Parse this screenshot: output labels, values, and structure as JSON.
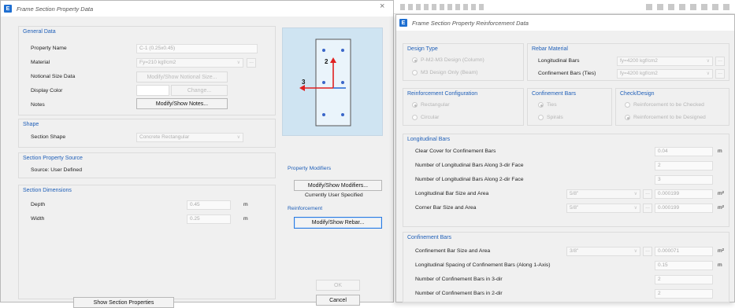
{
  "main": {
    "title": "Frame Section Property Data",
    "general": {
      "header": "General Data",
      "property_name_label": "Property Name",
      "property_name_value": "C-1 (0.25x0.45)",
      "material_label": "Material",
      "material_value": "Fy=210 kgf/cm2",
      "notional_label": "Notional Size Data",
      "notional_button": "Modify/Show Notional Size...",
      "display_color_label": "Display Color",
      "change_button": "Change...",
      "notes_label": "Notes",
      "notes_button": "Modify/Show Notes..."
    },
    "shape": {
      "header": "Shape",
      "section_shape_label": "Section Shape",
      "section_shape_value": "Concrete Rectangular"
    },
    "source": {
      "header": "Section Property Source",
      "source_text": "Source:  User Defined"
    },
    "dimensions": {
      "header": "Section Dimensions",
      "depth_label": "Depth",
      "depth_value": "0.45",
      "depth_unit": "m",
      "width_label": "Width",
      "width_value": "0.25",
      "width_unit": "m"
    },
    "preview": {
      "axis2_label": "2",
      "axis3_label": "3"
    },
    "modifiers": {
      "header": "Property Modifiers",
      "button": "Modify/Show Modifiers...",
      "status": "Currently User Specified"
    },
    "reinforcement": {
      "header": "Reinforcement",
      "button": "Modify/Show Rebar..."
    },
    "show_props_button": "Show Section Properties",
    "ok_button": "OK",
    "cancel_button": "Cancel"
  },
  "rebar": {
    "title": "Frame Section Property Reinforcement Data",
    "design_type": {
      "header": "Design Type",
      "option1": "P-M2-M3 Design (Column)",
      "option2": "M3 Design Only (Beam)"
    },
    "rebar_material": {
      "header": "Rebar Material",
      "longitudinal_label": "Longitudinal Bars",
      "longitudinal_value": "fy=4200 kgf/cm2",
      "confinement_label": "Confinement Bars (Ties)",
      "confinement_value": "fy=4200 kgf/cm2"
    },
    "config": {
      "header": "Reinforcement Configuration",
      "option1": "Rectangular",
      "option2": "Circular"
    },
    "confinement_type": {
      "header": "Confinement Bars",
      "option1": "Ties",
      "option2": "Spirals"
    },
    "check_design": {
      "header": "Check/Design",
      "option1": "Reinforcement to be Checked",
      "option2": "Reinforcement to be Designed"
    },
    "longitudinal": {
      "header": "Longitudinal Bars",
      "clear_cover_label": "Clear Cover for Confinement Bars",
      "clear_cover_value": "0.04",
      "clear_cover_unit": "m",
      "num_3dir_label": "Number of Longitudinal Bars Along 3-dir Face",
      "num_3dir_value": "2",
      "num_2dir_label": "Number of Longitudinal Bars Along 2-dir Face",
      "num_2dir_value": "3",
      "bar_size_label": "Longitudinal Bar Size and Area",
      "bar_size_value": "5/8\"",
      "bar_area_value": "0.000199",
      "bar_area_unit": "m²",
      "corner_label": "Corner Bar Size and Area",
      "corner_size_value": "5/8\"",
      "corner_area_value": "0.000199",
      "corner_area_unit": "m²"
    },
    "confinement": {
      "header": "Confinement Bars",
      "size_label": "Confinement Bar Size and Area",
      "size_value": "3/8\"",
      "area_value": "0.000071",
      "area_unit": "m²",
      "spacing_label": "Longitudinal Spacing of Confinement Bars  (Along 1-Axis)",
      "spacing_value": "0.15",
      "spacing_unit": "m",
      "num3_label": "Number of Confinement Bars in 3-dir",
      "num3_value": "2",
      "num2_label": "Number of Confinement Bars in 2-dir",
      "num2_value": "2"
    }
  },
  "colors": {
    "accent": "#1f5fb8",
    "title_icon": "#1f6fd1",
    "preview_bg": "#cfe4f2",
    "axis_red": "#e02020",
    "axis_blue": "#2f6fd6",
    "section_fill": "#eaf4fb"
  }
}
